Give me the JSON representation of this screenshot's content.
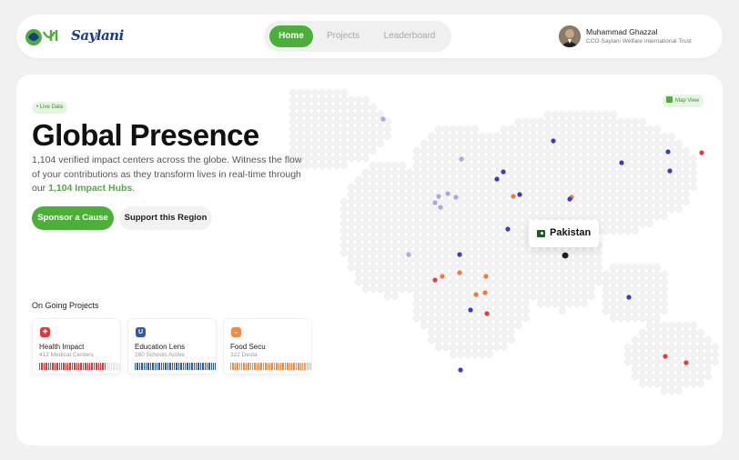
{
  "brand": {
    "name": "Saylani",
    "urdu_mark": "سیلانی"
  },
  "nav": {
    "items": [
      {
        "label": "Home",
        "active": true
      },
      {
        "label": "Projects",
        "active": false
      },
      {
        "label": "Leaderboard",
        "active": false
      }
    ]
  },
  "user": {
    "name": "Muhammad Ghazzal",
    "role": "CCO-Saylani Welfare International Trust"
  },
  "hero": {
    "badge": "• Live Data",
    "title": "Global Presence",
    "desc_1": "1,104 verified impact centers across the globe. Witness the flow of your contributions as they transform lives in real-time through our ",
    "desc_hl": "1,104 Impact Hubs",
    "desc_end": ".",
    "cta_primary": "Sponsor a Cause",
    "cta_secondary": "Support this Region"
  },
  "projects": {
    "section_title": "On Going Projects",
    "items": [
      {
        "title": "Health Impact",
        "subtitle": "412 Medical Centers",
        "icon": "health-icon",
        "color": "#d93b3b",
        "level": 0.7
      },
      {
        "title": "Education Lens",
        "subtitle": "280 Schools Active",
        "icon": "education-icon",
        "color": "#2f5aa8",
        "level": 1.0
      },
      {
        "title": "Food Secu",
        "subtitle": "322 Desta",
        "icon": "food-icon",
        "color": "#f08a45",
        "level": 1.0
      }
    ]
  },
  "map": {
    "view_label": "Map View",
    "selected_country": "Pakistan",
    "marker_colors": {
      "blue": "#3a3ac8",
      "orange": "#f07a3a",
      "red": "#e83a3a",
      "lavender": "#a8a8e8"
    }
  }
}
